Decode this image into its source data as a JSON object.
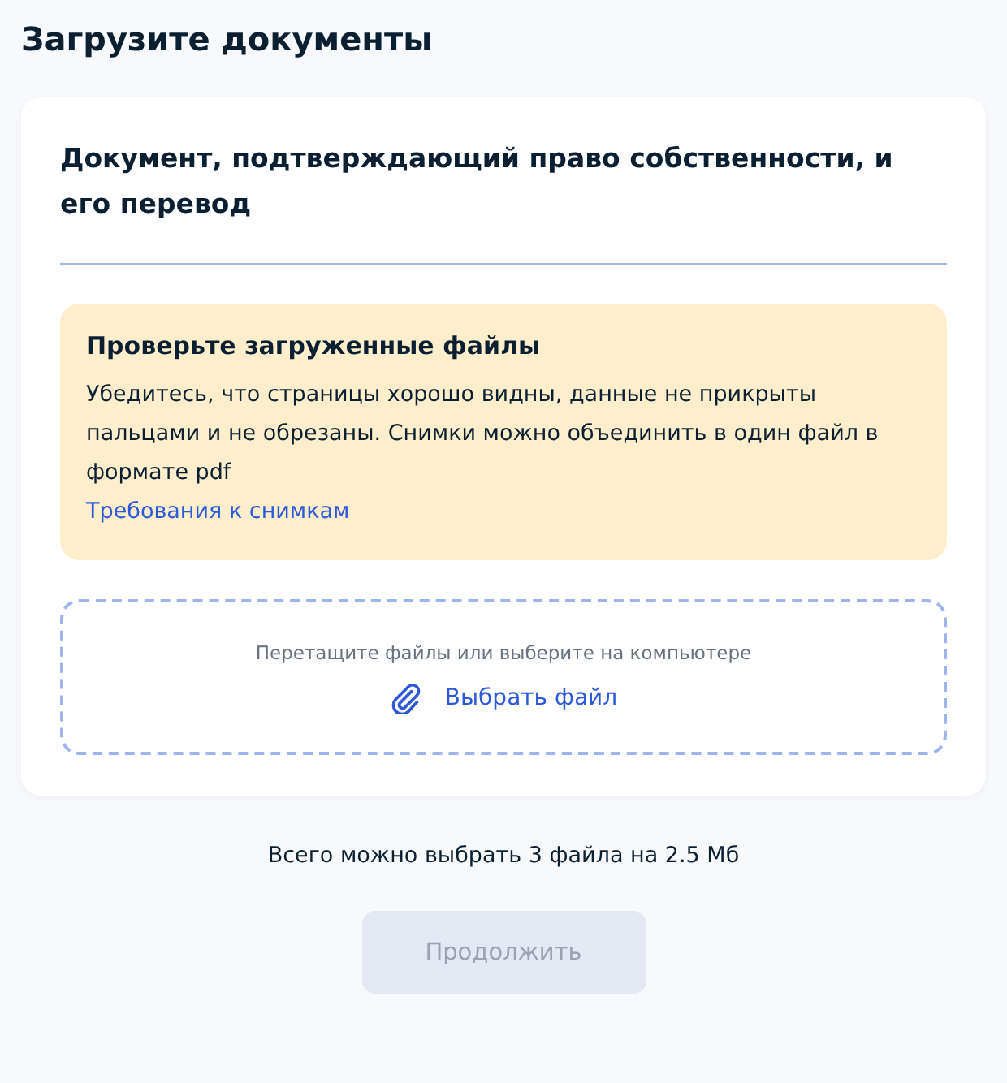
{
  "page_title": "Загрузите документы",
  "card": {
    "heading": "Документ, подтверждающий право собственности, и его перевод",
    "notice": {
      "title": "Проверьте загруженные файлы",
      "text": "Убедитесь, что страницы хорошо видны, данные не прикрыты пальцами и не обрезаны. Снимки можно объединить в один файл в формате pdf",
      "link": "Требования к снимкам"
    },
    "dropzone": {
      "hint": "Перетащите файлы или выберите на компьютере",
      "button": "Выбрать файл"
    }
  },
  "limit_text": "Всего можно выбрать 3 файла на 2.5 Мб",
  "continue_button": {
    "label": "Продолжить",
    "disabled": true
  }
}
